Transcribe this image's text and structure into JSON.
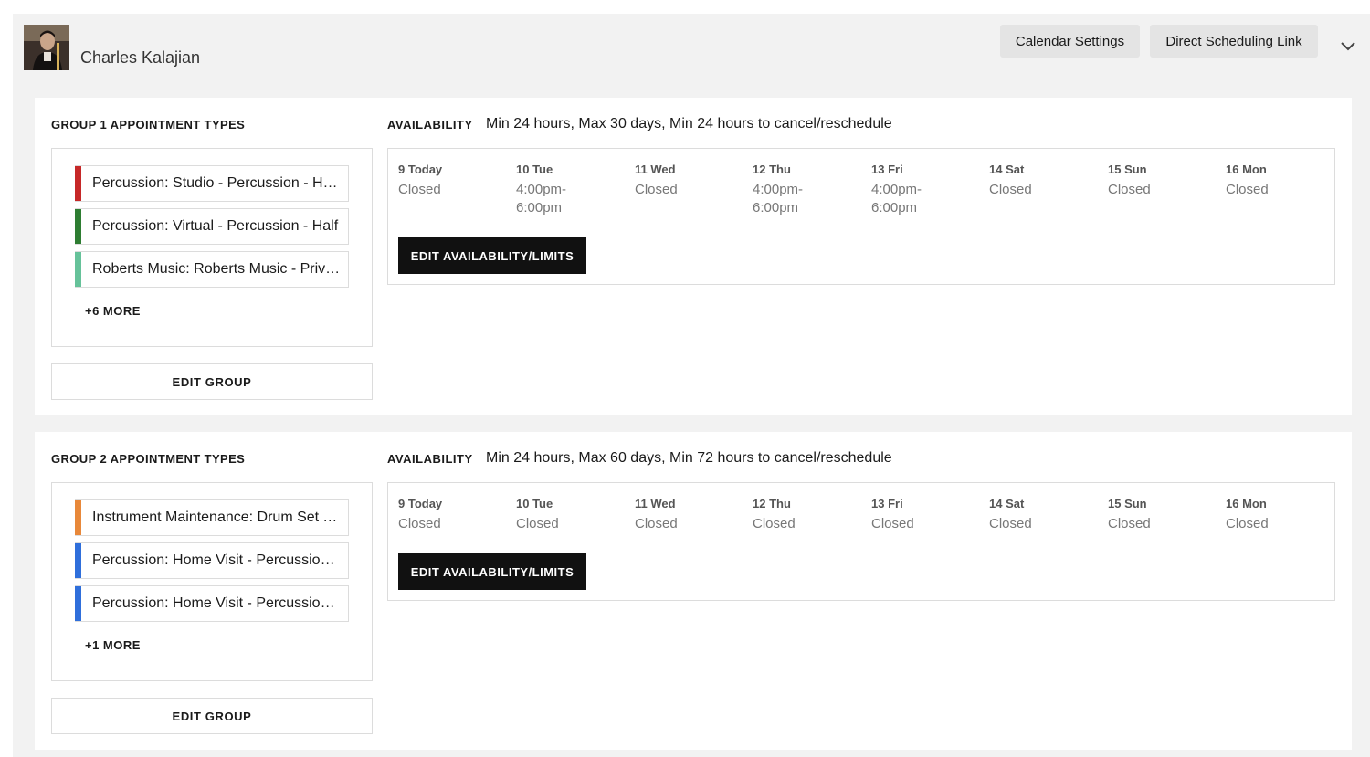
{
  "user": {
    "name": "Charles Kalajian"
  },
  "header": {
    "calendar_settings": "Calendar Settings",
    "direct_link": "Direct Scheduling Link"
  },
  "labels": {
    "availability": "AVAILABILITY",
    "edit_availability": "EDIT AVAILABILITY/LIMITS",
    "edit_group": "EDIT GROUP"
  },
  "groups": [
    {
      "title": "GROUP 1 APPOINTMENT TYPES",
      "availability_text": "Min 24 hours, Max 30 days, Min 24 hours to cancel/reschedule",
      "types": [
        {
          "label": "Percussion: Studio - Percussion - Half Hour",
          "color": "#c62828"
        },
        {
          "label": "Percussion: Virtual - Percussion - Half",
          "color": "#2e7d32"
        },
        {
          "label": "Roberts Music: Roberts Music - Private Lesson",
          "color": "#66c29a"
        }
      ],
      "more": "+6 MORE",
      "days": [
        {
          "name": "9 Today",
          "hours": "Closed"
        },
        {
          "name": "10 Tue",
          "hours": "4:00pm-6:00pm"
        },
        {
          "name": "11 Wed",
          "hours": "Closed"
        },
        {
          "name": "12 Thu",
          "hours": "4:00pm-6:00pm"
        },
        {
          "name": "13 Fri",
          "hours": "4:00pm-6:00pm"
        },
        {
          "name": "14 Sat",
          "hours": "Closed"
        },
        {
          "name": "15 Sun",
          "hours": "Closed"
        },
        {
          "name": "16 Mon",
          "hours": "Closed"
        }
      ]
    },
    {
      "title": "GROUP 2 APPOINTMENT TYPES",
      "availability_text": "Min 24 hours, Max 60 days, Min 72 hours to cancel/reschedule",
      "types": [
        {
          "label": "Instrument Maintenance: Drum Set Tuning",
          "color": "#e8883a"
        },
        {
          "label": "Percussion: Home Visit - Percussion - Half Hour",
          "color": "#2f6fdb"
        },
        {
          "label": "Percussion: Home Visit - Percussion - Hour",
          "color": "#2f6fdb"
        }
      ],
      "more": "+1 MORE",
      "days": [
        {
          "name": "9 Today",
          "hours": "Closed"
        },
        {
          "name": "10 Tue",
          "hours": "Closed"
        },
        {
          "name": "11 Wed",
          "hours": "Closed"
        },
        {
          "name": "12 Thu",
          "hours": "Closed"
        },
        {
          "name": "13 Fri",
          "hours": "Closed"
        },
        {
          "name": "14 Sat",
          "hours": "Closed"
        },
        {
          "name": "15 Sun",
          "hours": "Closed"
        },
        {
          "name": "16 Mon",
          "hours": "Closed"
        }
      ]
    }
  ]
}
